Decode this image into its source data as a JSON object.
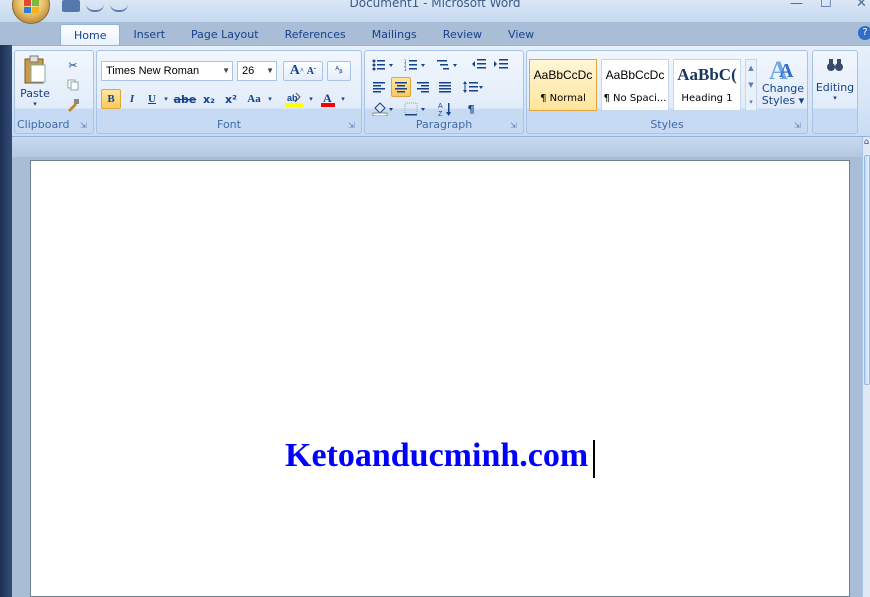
{
  "window": {
    "title": "Document1 - Microsoft Word",
    "min": "—",
    "max": "☐",
    "close": "✕"
  },
  "tabs": [
    {
      "label": "Home"
    },
    {
      "label": "Insert"
    },
    {
      "label": "Page Layout"
    },
    {
      "label": "References"
    },
    {
      "label": "Mailings"
    },
    {
      "label": "Review"
    },
    {
      "label": "View"
    }
  ],
  "clipboard": {
    "paste": "Paste",
    "group": "Clipboard"
  },
  "font": {
    "family": "Times New Roman",
    "size": "26",
    "group": "Font",
    "bold": "B",
    "italic": "I",
    "underline": "U",
    "strike": "abe",
    "sub": "x₂",
    "sup": "x²",
    "case": "Aa",
    "grow": "A",
    "shrink": "A"
  },
  "paragraph": {
    "group": "Paragraph"
  },
  "styles": {
    "group": "Styles",
    "items": [
      {
        "preview": "AaBbCcDc",
        "name": "¶ Normal"
      },
      {
        "preview": "AaBbCcDc",
        "name": "¶ No Spaci..."
      },
      {
        "preview": "AaBbC(",
        "name": "Heading 1"
      }
    ],
    "change": "Change",
    "change2": "Styles ▾"
  },
  "editing": {
    "label": "Editing"
  },
  "document": {
    "text": "Ketoanducminh.com"
  },
  "colors": {
    "text": "#0000ff",
    "accent": "#15428b"
  }
}
